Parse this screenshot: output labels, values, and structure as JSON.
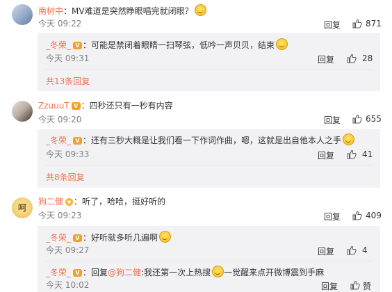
{
  "actions": {
    "reply": "回复",
    "like_label": "赞"
  },
  "comments": [
    {
      "username": "南树中",
      "text": "：MV难道是突然睁眼唱完就闭眼？",
      "time": "今天 09:22",
      "likes": "871",
      "replies": [
        {
          "username": "_冬荣_",
          "text": "：可能是禁闭着眼睛一扫琴弦，低吟一声贝贝，结束",
          "time": "今天 09:31",
          "likes": "28"
        }
      ],
      "more": "共13条回复"
    },
    {
      "username": "ZzuuuT",
      "text": "：四秒还只有一秒有内容",
      "time": "今天 09:20",
      "likes": "655",
      "replies": [
        {
          "username": "_冬荣_",
          "text": "：还有三秒大概是让我们看一下作词作曲，嗯，这就是出自他本人之手",
          "time": "今天 09:33",
          "likes": "41"
        }
      ],
      "more": "共8条回复"
    },
    {
      "username": "狗二健",
      "avatar_text": "呵",
      "text": "：听了，哈哈，挺好听的",
      "time": "今天 09:23",
      "likes": "409",
      "replies": [
        {
          "username": "_冬荣_",
          "text": "：好听就多听几遍啊",
          "time": "今天 09:27",
          "likes": "4"
        },
        {
          "username": "_冬荣_",
          "text_pre": "：回复",
          "mention": "@狗二健",
          "text_post": ":我还第一次上热搜",
          "text_after": "一觉醒来点开微博震到手麻",
          "time": "今天 10:02"
        }
      ]
    }
  ]
}
